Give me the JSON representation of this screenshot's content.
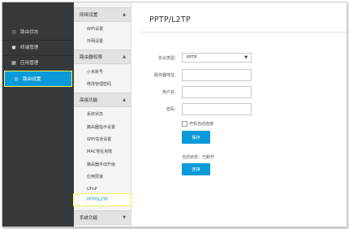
{
  "left_nav": {
    "items": [
      {
        "label": "路由状态",
        "icon": "gauge-icon",
        "glyph": "◷"
      },
      {
        "label": "终端管理",
        "icon": "user-icon",
        "glyph": "●"
      },
      {
        "label": "应用管理",
        "icon": "grid-icon",
        "glyph": "▦"
      },
      {
        "label": "路由设置",
        "icon": "settings-icon",
        "glyph": "◎"
      }
    ],
    "active_index": 3
  },
  "sub_nav": {
    "groups": [
      {
        "label": "网络设置",
        "items": [
          "WiFi设置",
          "外网设置"
        ]
      },
      {
        "label": "路由器权限",
        "items": [
          "小米账号",
          "修改管理密码"
        ]
      },
      {
        "label": "高级功能",
        "items": [
          "系统状态",
          "路由器指示设置",
          "WiFi信道设置",
          "MAC地址克隆",
          "路由器手动升级",
          "应用限速",
          "UPnP",
          "PPTP/L2TP"
        ]
      },
      {
        "label": "系统功能",
        "items": []
      }
    ],
    "active_item": "PPTP/L2TP",
    "chevron": "▲",
    "chevron_down": "▼"
  },
  "main": {
    "title": "PPTP/L2TP",
    "protocol_label": "协议类型：",
    "protocol_value": "PPTP",
    "server_label": "服务器地址：",
    "server_value": "",
    "username_label": "用户名：",
    "username_value": "",
    "password_label": "密码：",
    "password_value": "",
    "autostart_label": "开机自动连接",
    "autostart_checked": false,
    "save_label": "保存",
    "status_text": "当前状态：已断开",
    "connect_label": "连接"
  },
  "colors": {
    "sidebar_bg": "#35393c",
    "accent_blue": "#0a9ad9",
    "highlight_outline": "#f3f14a"
  }
}
